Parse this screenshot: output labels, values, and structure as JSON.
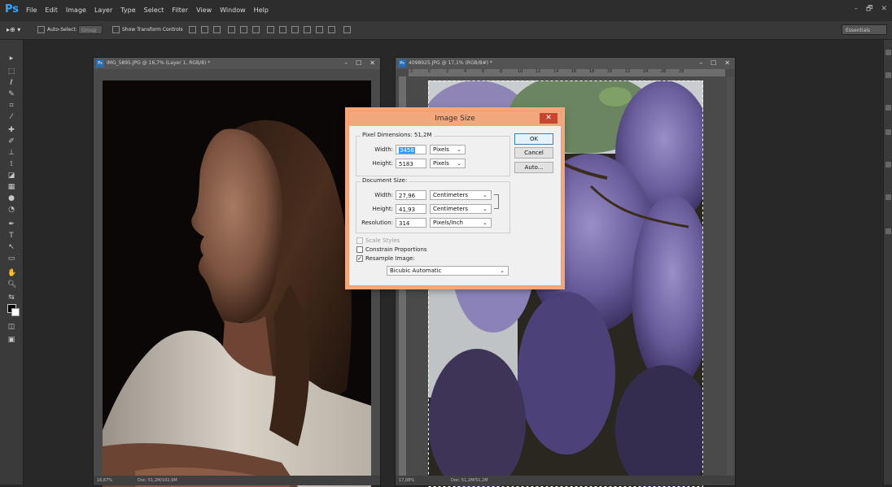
{
  "app": {
    "logo": "Ps",
    "menu": [
      "File",
      "Edit",
      "Image",
      "Layer",
      "Type",
      "Select",
      "Filter",
      "View",
      "Window",
      "Help"
    ],
    "window_controls": [
      "–",
      "🗗",
      "✕"
    ]
  },
  "options_bar": {
    "auto_select_label": "Auto-Select:",
    "auto_select_value": "Group",
    "show_transform_label": "Show Transform Controls",
    "workspace": "Essentials"
  },
  "documents": [
    {
      "title": "IMG_5895.JPG @ 16,7% (Layer 1, RGB/8) *",
      "zoom": "16,67%",
      "doc_info": "Doc: 51,2M/102,9M",
      "controls": [
        "–",
        "☐",
        "✕"
      ]
    },
    {
      "title": "4098925.JPG @ 17,1% (RGB/8#) *",
      "zoom": "17,08%",
      "doc_info": "Doc: 51,2M/51,2M",
      "ruler_ticks": [
        "2",
        "0",
        "2",
        "4",
        "6",
        "8",
        "10",
        "12",
        "14",
        "16",
        "18",
        "20",
        "22",
        "24",
        "26",
        "28"
      ],
      "controls": [
        "–",
        "☐",
        "✕"
      ]
    }
  ],
  "dialog": {
    "title": "Image Size",
    "close": "✕",
    "pixel_dimensions_label": "Pixel Dimensions:",
    "pixel_dimensions_value": "51,2M",
    "px_width_label": "Width:",
    "px_width_value": "3456",
    "px_width_unit": "Pixels",
    "px_height_label": "Height:",
    "px_height_value": "5183",
    "px_height_unit": "Pixels",
    "document_size_label": "Document Size:",
    "doc_width_label": "Width:",
    "doc_width_value": "27,96",
    "doc_width_unit": "Centimeters",
    "doc_height_label": "Height:",
    "doc_height_value": "41,93",
    "doc_height_unit": "Centimeters",
    "resolution_label": "Resolution:",
    "resolution_value": "314",
    "resolution_unit": "Pixels/Inch",
    "scale_styles_label": "Scale Styles",
    "scale_styles_checked": false,
    "constrain_label": "Constrain Proportions",
    "constrain_checked": false,
    "resample_label": "Resample Image:",
    "resample_checked": true,
    "resample_method": "Bicubic Automatic",
    "ok_label": "OK",
    "cancel_label": "Cancel",
    "auto_label": "Auto...",
    "check_glyph": "✓",
    "chevron": "⌄"
  },
  "colors": {
    "accent_dialog": "#f3a77c",
    "ps_blue": "#31a8ff"
  }
}
